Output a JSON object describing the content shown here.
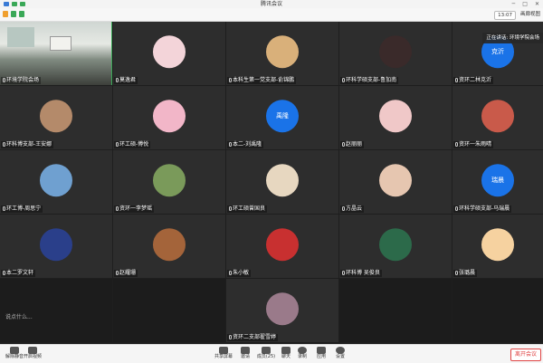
{
  "window": {
    "title": "腾讯会议"
  },
  "toolbar": {
    "time": "13:07",
    "view_label": "画廊视图"
  },
  "speaker_tip": "正在讲话: 环境学院会场",
  "chat_snip": "说点什么...",
  "participants": [
    {
      "name": "环境学院会场",
      "type": "photo"
    },
    {
      "name": "莫逸君",
      "type": "avatar",
      "color": "#f3d4d9"
    },
    {
      "name": "本科生第一党支部-俞锦鹏",
      "type": "avatar",
      "color": "#d9b07a"
    },
    {
      "name": "环科学硕支部-鲁加南",
      "type": "avatar",
      "color": "#3a2a2a"
    },
    {
      "name": "资环二林克沂",
      "type": "text",
      "initials": "克沂"
    },
    {
      "name": "环科博支部-王安娜",
      "type": "avatar",
      "color": "#b48a6a"
    },
    {
      "name": "环工硕-傅悦",
      "type": "avatar",
      "color": "#f2b6c8"
    },
    {
      "name": "本二-刘禹隆",
      "type": "text",
      "initials": "禹隆"
    },
    {
      "name": "赵丽丽",
      "type": "avatar",
      "color": "#f0c8c8"
    },
    {
      "name": "资环一朱雨晴",
      "type": "avatar",
      "color": "#c95a4a"
    },
    {
      "name": "环工博-周思宁",
      "type": "avatar",
      "color": "#6fa0d0"
    },
    {
      "name": "资环一李梦瑶",
      "type": "avatar",
      "color": "#7a9a5a"
    },
    {
      "name": "环工硕曾国良",
      "type": "avatar",
      "color": "#e7d7c0"
    },
    {
      "name": "方晶云",
      "type": "avatar",
      "color": "#e6c6b0"
    },
    {
      "name": "环科学硕支部-马瑞晨",
      "type": "text",
      "initials": "瑞晨"
    },
    {
      "name": "本二罗文轩",
      "type": "avatar",
      "color": "#2a3f8a"
    },
    {
      "name": "赵耀珊",
      "type": "avatar",
      "color": "#a4643a"
    },
    {
      "name": "朱小敏",
      "type": "avatar",
      "color": "#c83030"
    },
    {
      "name": "环科博 吴俊良",
      "type": "avatar",
      "color": "#2c6a4a"
    },
    {
      "name": "张璐晨",
      "type": "avatar",
      "color": "#f6d2a0"
    },
    {
      "name": "",
      "type": "empty"
    },
    {
      "name": "",
      "type": "empty"
    },
    {
      "name": "资环二支部翟雪婷",
      "type": "avatar",
      "color": "#9a7a8a"
    },
    {
      "name": "",
      "type": "empty"
    },
    {
      "name": "",
      "type": "empty"
    }
  ],
  "bottom": {
    "left": [
      {
        "label": "解除静音"
      },
      {
        "label": "开启视频"
      }
    ],
    "center": [
      {
        "label": "共享屏幕"
      },
      {
        "label": "邀请"
      },
      {
        "label": "成员(25)"
      },
      {
        "label": "聊天"
      },
      {
        "label": "录制"
      },
      {
        "label": "应用"
      },
      {
        "label": "设置"
      }
    ],
    "leave_label": "离开会议"
  }
}
